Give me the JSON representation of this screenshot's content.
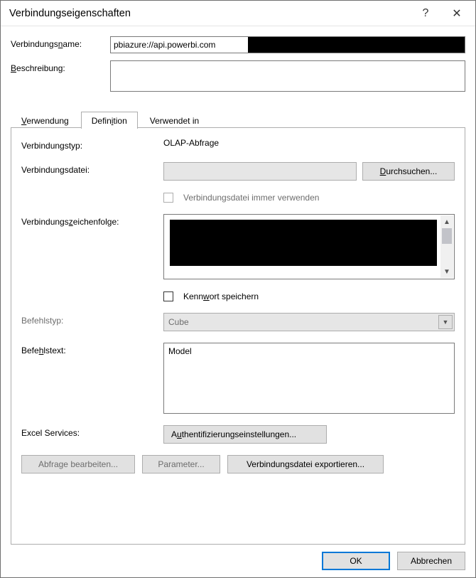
{
  "title": "Verbindungseigenschaften",
  "help_glyph": "?",
  "close_glyph": "✕",
  "labels": {
    "connection_name": "Verbindungsname:",
    "connection_name_underline_char": "n",
    "description": "Beschreibung:",
    "description_underline_char": "B"
  },
  "fields": {
    "connection_name": "pbiazure://api.powerbi.com ",
    "description": ""
  },
  "tabs": {
    "usage": "Verwendung",
    "definition": "Definition",
    "used_in": "Verwendet in"
  },
  "definition": {
    "connection_type_label": "Verbindungstyp:",
    "connection_type_value": "OLAP-Abfrage",
    "connection_file_label": "Verbindungsdatei:",
    "browse_btn": "Durchsuchen...",
    "always_use_file": "Verbindungsdatei immer verwenden",
    "connection_string_label": "Verbindungszeichenfolge:",
    "connection_string_value": "",
    "save_password": "Kennwort speichern",
    "command_type_label": "Befehlstyp:",
    "command_type_value": "Cube",
    "command_text_label": "Befehlstext:",
    "command_text_value": "Model",
    "excel_services_label": "Excel Services:",
    "auth_settings_btn": "Authentifizierungseinstellungen...",
    "edit_query_btn": "Abfrage bearbeiten...",
    "parameters_btn": "Parameter...",
    "export_file_btn": "Verbindungsdatei exportieren..."
  },
  "footer": {
    "ok": "OK",
    "cancel": "Abbrechen"
  }
}
